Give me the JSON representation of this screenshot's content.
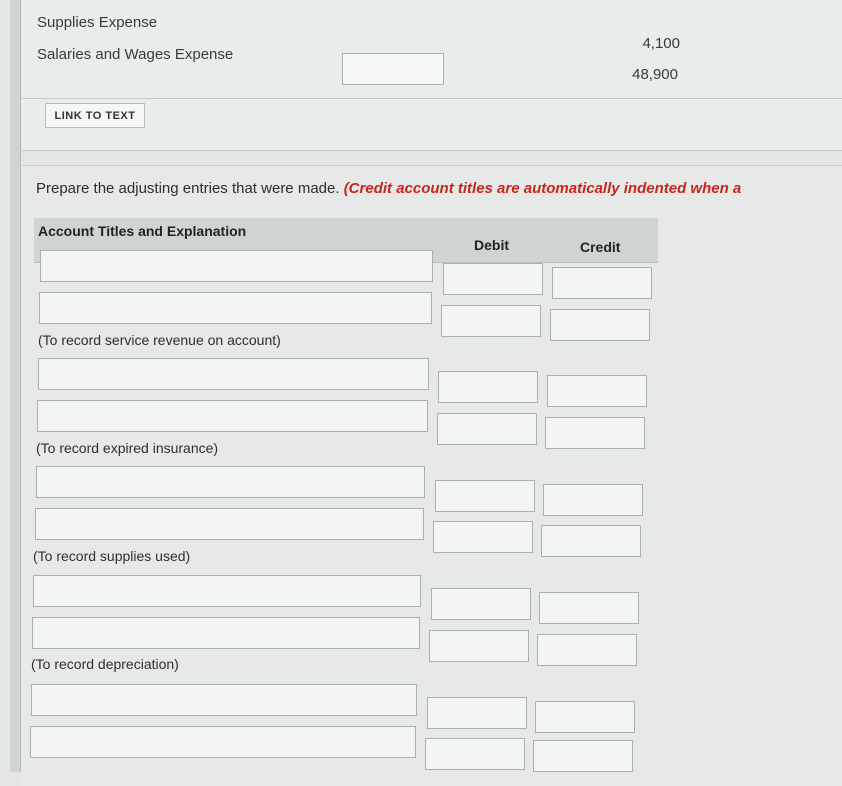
{
  "top_section": {
    "rows": [
      {
        "label": "Supplies Expense",
        "amount": "4,100"
      },
      {
        "label": "Salaries and Wages Expense",
        "amount": "48,900"
      }
    ],
    "link_to_text": "LINK TO TEXT"
  },
  "instruction": {
    "text": "Prepare the adjusting entries that were made.",
    "hint": "(Credit account titles are automatically indented when a"
  },
  "table": {
    "headers": {
      "account": "Account Titles and Explanation",
      "debit": "Debit",
      "credit": "Credit"
    },
    "entries": [
      {
        "note": "(To record service revenue on account)"
      },
      {
        "note": "(To record expired insurance)"
      },
      {
        "note": "(To record supplies used)"
      },
      {
        "note": "(To record depreciation)"
      },
      {
        "note": ""
      }
    ]
  }
}
